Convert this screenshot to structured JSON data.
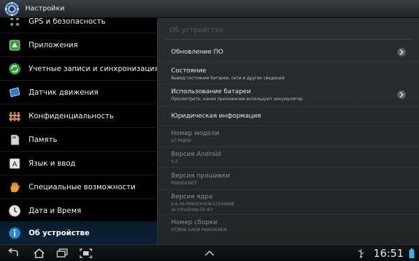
{
  "window": {
    "title": "Настройки",
    "app_icon": "settings-gear-icon"
  },
  "sidebar": {
    "items": [
      {
        "label": "GPS и безопасность",
        "icon": "gps-security-icon",
        "active": false
      },
      {
        "label": "Приложения",
        "icon": "applications-icon",
        "active": false
      },
      {
        "label": "Учетные записи и синхронизация",
        "icon": "sync-icon",
        "active": false
      },
      {
        "label": "Датчик движения",
        "icon": "motion-sensor-icon",
        "active": false
      },
      {
        "label": "Конфиденциальность",
        "icon": "privacy-fence-icon",
        "active": false
      },
      {
        "label": "Память",
        "icon": "storage-icon",
        "active": false
      },
      {
        "label": "Язык и ввод",
        "icon": "language-icon",
        "active": false
      },
      {
        "label": "Специальные возможности",
        "icon": "accessibility-hand-icon",
        "active": false
      },
      {
        "label": "Дата и Время",
        "icon": "clock-icon",
        "active": false
      },
      {
        "label": "Об устройстве",
        "icon": "info-icon",
        "active": true
      }
    ]
  },
  "main": {
    "header": "Об устройстве",
    "rows": [
      {
        "title": "Обновление ПО",
        "subtitle": "",
        "chevron": true
      },
      {
        "title": "Состояние",
        "subtitle": "Вывод состояния батареи, сети и других сведений",
        "chevron": false
      },
      {
        "title": "Использование батареи",
        "subtitle": "Просмотрите, какие приложения используют аккумулятор",
        "chevron": true
      },
      {
        "title": "Юридическая информация",
        "subtitle": "",
        "chevron": false
      }
    ],
    "info": [
      {
        "title": "Номер модели",
        "value": "GT-P6800"
      },
      {
        "title": "Версия Android",
        "value": "3.2"
      },
      {
        "title": "Версия прошивки",
        "value": "P6800XXKI7"
      },
      {
        "title": "Версия ядра",
        "value": "2.6.36-P6800XXKI8-CL549968",
        "value2": "se.infra@sep-59 #3"
      },
      {
        "title": "Номер сборки",
        "value": "HTJ85B.XXKI8 P6800XXKI8"
      }
    ]
  },
  "navbar": {
    "time": "16:51",
    "buttons": [
      "back-icon",
      "home-icon",
      "recent-apps-icon",
      "screenshot-icon",
      "up-arrow-icon",
      "usb-icon",
      "battery-icon"
    ]
  },
  "colors": {
    "accent_active": "#0b2236",
    "info_blue": "#1a8fd8"
  }
}
